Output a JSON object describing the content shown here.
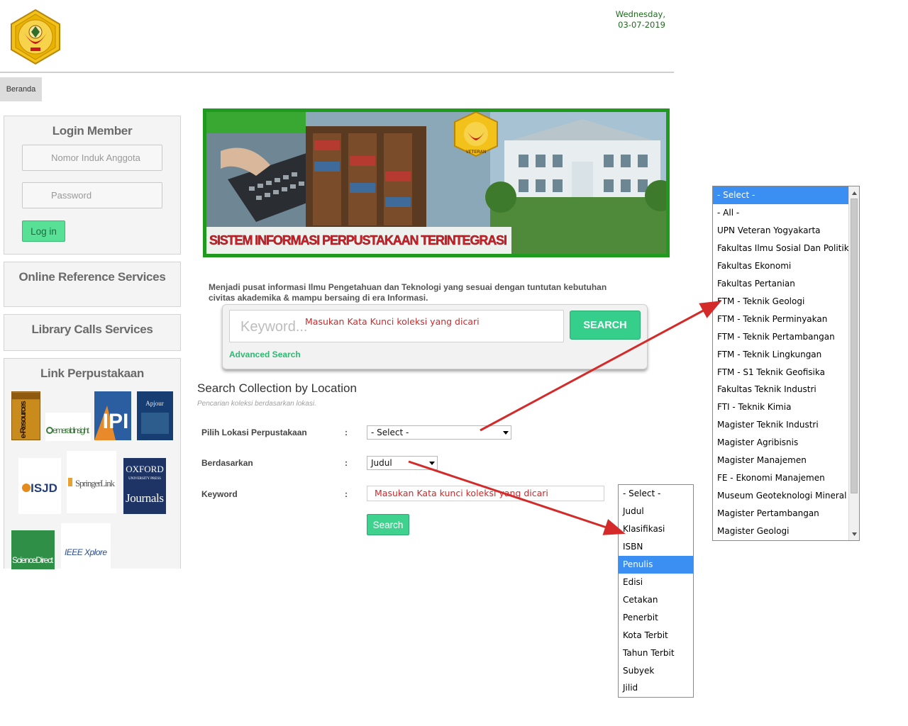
{
  "header": {
    "day": "Wednesday,",
    "date": "03-07-2019",
    "logo_text_top": "UNIVERSITAS PEMBANGUNAN NASIONAL \"VETERAN\"",
    "logo_text_bottom": "YOGYAKARTA"
  },
  "nav": {
    "beranda": "Beranda"
  },
  "login": {
    "title": "Login Member",
    "member_placeholder": "Nomor Induk Anggota",
    "password_placeholder": "Password",
    "login_button": "Log in"
  },
  "sidebar": {
    "online_reference": "Online Reference Services",
    "library_calls": "Library Calls Services",
    "links_title": "Link Perpustakaan",
    "links": [
      {
        "name": "e-Resources",
        "text": "e-Resources"
      },
      {
        "name": "emerald",
        "text": "emeraldinsight"
      },
      {
        "name": "ipi",
        "text": "IPI"
      },
      {
        "name": "apjournal",
        "text": "Apjour"
      },
      {
        "name": "isjd",
        "text": "ISJD"
      },
      {
        "name": "springer",
        "text": "SpringerLink"
      },
      {
        "name": "oxford",
        "text": "OXFORD",
        "text2": "UNIVERSITY PRESS",
        "text3": "Journals"
      },
      {
        "name": "sciencedirect",
        "text": "ScienceDirect"
      },
      {
        "name": "ieee",
        "text": "IEEE Xplore"
      }
    ]
  },
  "banner": {
    "text": "SISTEM INFORMASI PERPUSTAKAAN TERINTEGRASI",
    "logo_text": "VETERAN"
  },
  "tagline": "Menjadi pusat informasi Ilmu Pengetahuan dan Teknologi yang sesuai dengan tuntutan kebutuhan civitas akademika & mampu bersaing di era Informasi.",
  "search": {
    "placeholder": "Keyword...",
    "hint": "Masukan Kata Kunci koleksi yang dicari",
    "button": "SEARCH",
    "advanced": "Advanced Search"
  },
  "location_search": {
    "title": "Search Collection by Location",
    "subtitle": "Pencarian koleksi berdasarkan lokasi.",
    "location_label": "Pilih Lokasi Perpustakaan",
    "by_label": "Berdasarkan",
    "keyword_label": "Keyword",
    "colon": ":",
    "location_value": "- Select -",
    "by_value": "Judul",
    "keyword_hint": "Masukan Kata kunci koleksi yang dicari",
    "search_button": "Search"
  },
  "location_options": [
    "- Select -",
    "- All -",
    "UPN Veteran Yogyakarta",
    "Fakultas Ilmu Sosial Dan Politik",
    "Fakultas Ekonomi",
    "Fakultas Pertanian",
    "FTM - Teknik Geologi",
    "FTM - Teknik Perminyakan",
    "FTM - Teknik Pertambangan",
    "FTM - Teknik Lingkungan",
    "FTM - S1 Teknik Geofisika",
    "Fakultas Teknik Industri",
    "FTI - Teknik Kimia",
    "Magister Teknik Industri",
    "Magister Agribisnis",
    "Magister Manajemen",
    "FE - Ekonomi Manajemen",
    "Museum Geoteknologi Mineral",
    "Magister Pertambangan",
    "Magister Geologi"
  ],
  "location_selected_index": 0,
  "by_options": [
    "- Select -",
    "Judul",
    "Klasifikasi",
    "ISBN",
    "Penulis",
    "Edisi",
    "Cetakan",
    "Penerbit",
    "Kota Terbit",
    "Tahun Terbit",
    "Subyek",
    "Jilid"
  ],
  "by_selected_index": 4,
  "colors": {
    "accent_green": "#35cf8b",
    "banner_green": "#1f9a1f",
    "annotation_red": "#d42a2a",
    "selected_blue": "#3b8ff2",
    "hint_red": "#d0282a"
  }
}
